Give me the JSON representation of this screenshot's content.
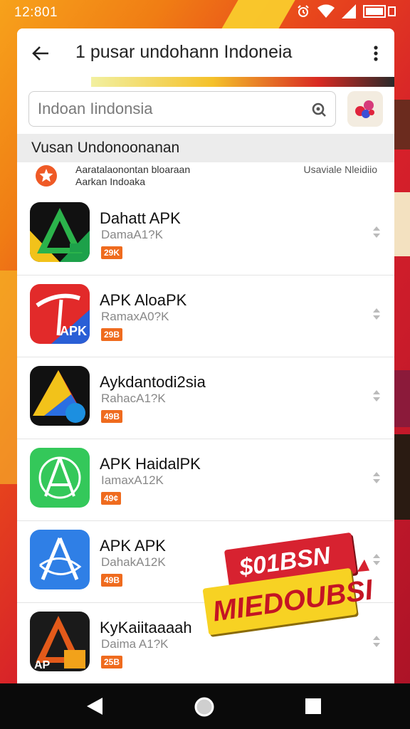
{
  "status_bar": {
    "time": "12:801",
    "icons": [
      "alarm-icon",
      "wifi-icon",
      "signal-icon",
      "battery-icon"
    ]
  },
  "app_bar": {
    "title": "1 pusar undohann Indoneia",
    "back_icon": "arrow-left-icon",
    "menu_icon": "more-vert-icon"
  },
  "search": {
    "placeholder": "Indoan Iindonsia",
    "icon": "search-icon"
  },
  "section": {
    "title": "Vusan Undonoonanan"
  },
  "promo": {
    "line1": "Aaratalaonontan bloaraan",
    "line2": "Aarkan Indoaka",
    "meta": "Usaviale Nleidiio"
  },
  "apps": [
    {
      "name": "Dahatt APK",
      "sub": "DamaA1?K",
      "badge": "29K"
    },
    {
      "name": "APK AloaPK",
      "sub": "RamaxA0?K",
      "badge": "29B"
    },
    {
      "name": "Aykdantodi2sia",
      "sub": "RahacA1?K",
      "badge": "49B"
    },
    {
      "name": "APK HaidalPK",
      "sub": "IamaxA12K",
      "badge": "49¢"
    },
    {
      "name": "APK APK",
      "sub": "DahakA12K",
      "badge": "49B"
    },
    {
      "name": "KyKaiitaaaah",
      "sub": "Daima A1?K",
      "badge": "25B"
    }
  ],
  "sticker": {
    "top_text": "$01BSN",
    "bottom_text": "MIEDOUBSI"
  },
  "colors": {
    "badge": "#ef6b1e",
    "sticker_red": "#d72230",
    "sticker_yellow": "#f7d223"
  }
}
